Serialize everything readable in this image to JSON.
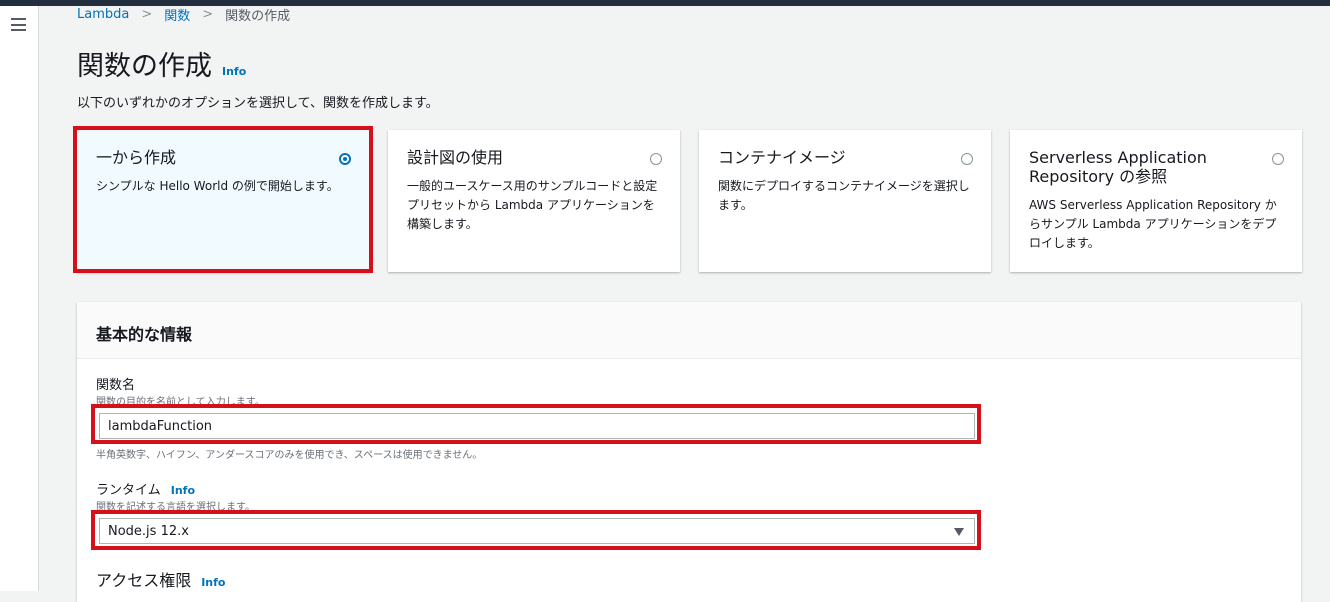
{
  "breadcrumb": [
    "Lambda",
    "関数",
    "関数の作成"
  ],
  "page": {
    "title": "関数の作成",
    "info": "Info",
    "subtitle": "以下のいずれかのオプションを選択して、関数を作成します。"
  },
  "options": [
    {
      "title": "一から作成",
      "desc": "シンプルな Hello World の例で開始します。",
      "selected": true
    },
    {
      "title": "設計図の使用",
      "desc": "一般的ユースケース用のサンプルコードと設定プリセットから Lambda アプリケーションを構築します。",
      "selected": false
    },
    {
      "title": "コンテナイメージ",
      "desc": "関数にデプロイするコンテナイメージを選択します。",
      "selected": false
    },
    {
      "title": "Serverless Application Repository の参照",
      "desc": "AWS Serverless Application Repository からサンプル Lambda アプリケーションをデプロイします。",
      "selected": false
    }
  ],
  "basic_info": {
    "header": "基本的な情報",
    "function_name": {
      "label": "関数名",
      "description": "関数の目的を名前として入力します。",
      "value": "lambdaFunction",
      "constraint": "半角英数字、ハイフン、アンダースコアのみを使用でき、スペースは使用できません。"
    },
    "runtime": {
      "label": "ランタイム",
      "info": "Info",
      "description": "関数を記述する言語を選択します。",
      "value": "Node.js 12.x"
    },
    "access": {
      "label": "アクセス権限",
      "info": "Info"
    }
  },
  "colors": {
    "accent": "#0073bb",
    "highlight": "#d6101a",
    "selected_card_bg": "#f1faff",
    "topbar": "#232f3e"
  }
}
